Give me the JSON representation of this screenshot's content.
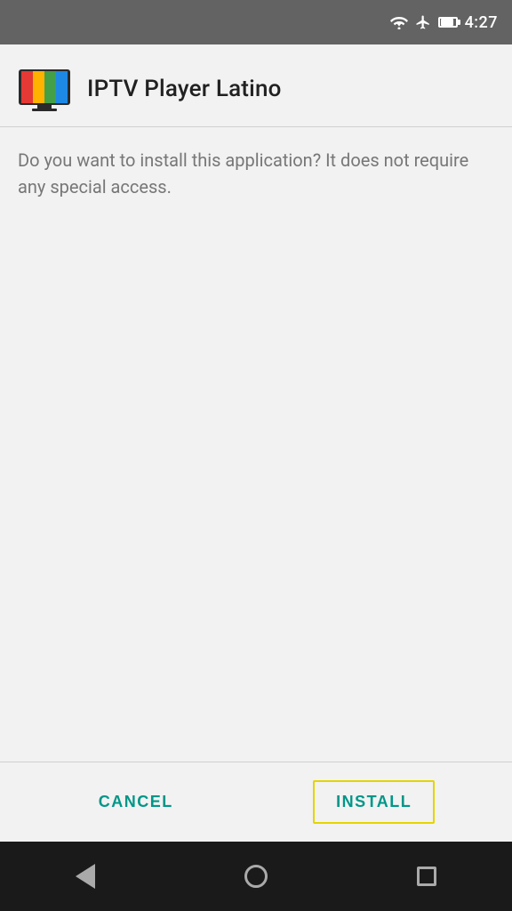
{
  "statusBar": {
    "time": "4:27",
    "icons": [
      "wifi",
      "airplane",
      "battery"
    ]
  },
  "header": {
    "appName": "IPTV Player Latino"
  },
  "content": {
    "description": "Do you want to install this application? It does not require any special access."
  },
  "actions": {
    "cancelLabel": "CANCEL",
    "installLabel": "INSTALL"
  },
  "navBar": {
    "backLabel": "back",
    "homeLabel": "home",
    "recentLabel": "recent"
  }
}
